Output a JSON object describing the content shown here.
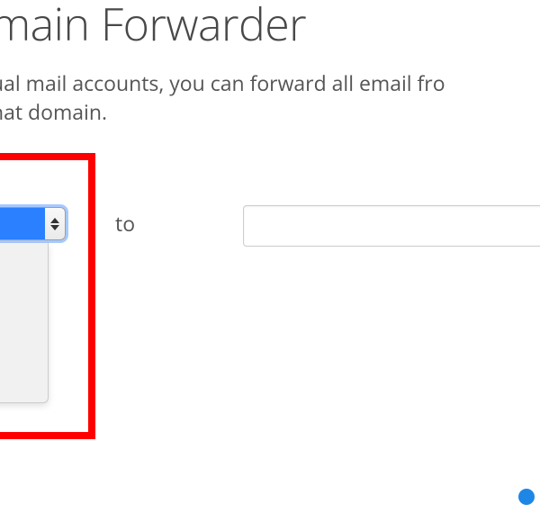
{
  "header": {
    "title": "main Forwarder"
  },
  "description": {
    "line1": "ual mail accounts, you can forward all email fro",
    "line2": "hat domain."
  },
  "form": {
    "to_label": "to",
    "source_selected": "",
    "dest_value": "",
    "dest_placeholder": ""
  },
  "colors": {
    "highlight": "#ff0000",
    "selection": "#2a80ff",
    "info": "#1e87e6"
  }
}
